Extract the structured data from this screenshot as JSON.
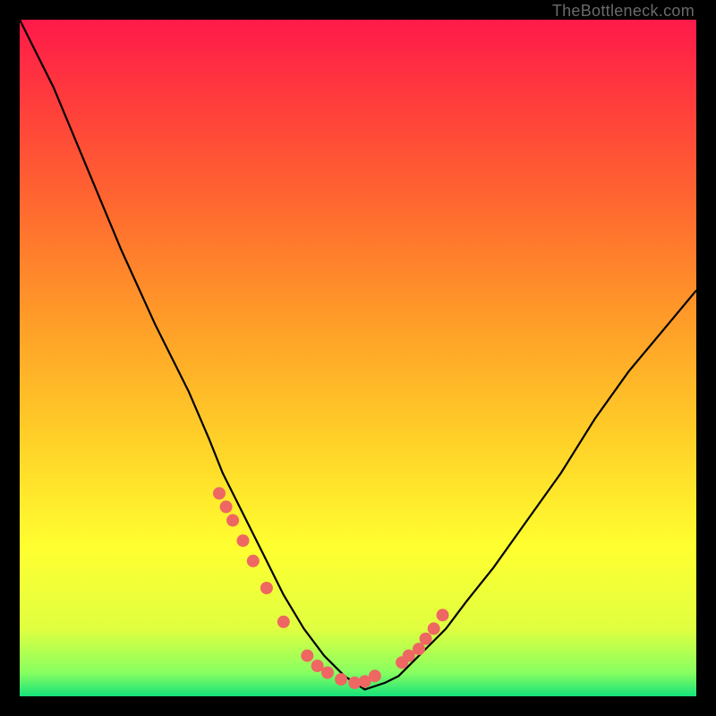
{
  "watermark": "TheBottleneck.com",
  "colors": {
    "frame": "#000000",
    "curve": "#000000",
    "marker": "#ee6762",
    "gradient_stops": [
      {
        "offset": 0.0,
        "color": "#ff1a4a"
      },
      {
        "offset": 0.12,
        "color": "#ff3c3c"
      },
      {
        "offset": 0.28,
        "color": "#ff6a2f"
      },
      {
        "offset": 0.45,
        "color": "#ff9e28"
      },
      {
        "offset": 0.62,
        "color": "#ffd028"
      },
      {
        "offset": 0.78,
        "color": "#ffff30"
      },
      {
        "offset": 0.9,
        "color": "#e0ff40"
      },
      {
        "offset": 0.965,
        "color": "#88ff60"
      },
      {
        "offset": 1.0,
        "color": "#16e27a"
      }
    ]
  },
  "chart_data": {
    "type": "line",
    "title": "",
    "xlabel": "",
    "ylabel": "",
    "ylim": [
      0,
      100
    ],
    "x": [
      0.0,
      0.05,
      0.1,
      0.15,
      0.2,
      0.25,
      0.28,
      0.3,
      0.33,
      0.36,
      0.39,
      0.42,
      0.45,
      0.48,
      0.51,
      0.54,
      0.56,
      0.58,
      0.6,
      0.63,
      0.66,
      0.7,
      0.75,
      0.8,
      0.85,
      0.9,
      0.95,
      1.0
    ],
    "values": [
      100,
      90,
      78,
      66,
      55,
      45,
      38,
      33,
      27,
      21,
      15,
      10,
      6,
      3,
      1,
      2,
      3,
      5,
      7,
      10,
      14,
      19,
      26,
      33,
      41,
      48,
      54,
      60
    ],
    "markers_x": [
      0.295,
      0.305,
      0.315,
      0.33,
      0.345,
      0.365,
      0.39,
      0.425,
      0.44,
      0.455,
      0.475,
      0.495,
      0.51,
      0.525,
      0.565,
      0.575,
      0.59,
      0.6,
      0.612,
      0.625
    ],
    "markers_y": [
      30,
      28,
      26,
      23,
      20,
      16,
      11,
      6,
      4.5,
      3.5,
      2.5,
      2,
      2.2,
      3,
      5,
      6,
      7,
      8.5,
      10,
      12
    ]
  }
}
